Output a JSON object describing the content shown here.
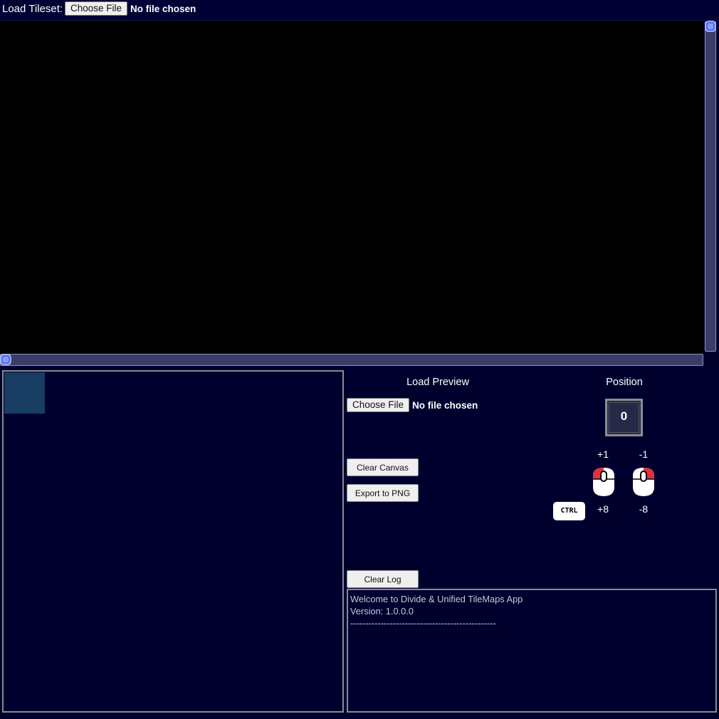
{
  "topbar": {
    "tileset_label": "Load Tileset:",
    "choose_file_label": "Choose File",
    "file_status": "No file chosen"
  },
  "preview": {
    "title": "Load Preview",
    "choose_file_label": "Choose File",
    "file_status": "No file chosen"
  },
  "actions": {
    "clear_canvas": "Clear Canvas",
    "export_png": "Export to PNG",
    "clear_log": "Clear Log"
  },
  "position": {
    "title": "Position",
    "value": "0",
    "left_click_label": "+1",
    "right_click_label": "-1",
    "ctrl_left_label": "+8",
    "ctrl_right_label": "-8",
    "ctrl_key_label": "CTRL"
  },
  "log": {
    "lines": [
      "Welcome to Divide & Unified TileMaps App",
      "Version: 1.0.0.0",
      "------------------------------------------------"
    ]
  },
  "colors": {
    "background": "#00002e",
    "canvas": "#000000",
    "selection": "#173d63",
    "scroll_thumb": "#4e6bff",
    "mouse_button": "#e0323e"
  },
  "icons": [
    "mouse-left-click-icon",
    "mouse-right-click-icon",
    "ctrl-key-icon"
  ]
}
